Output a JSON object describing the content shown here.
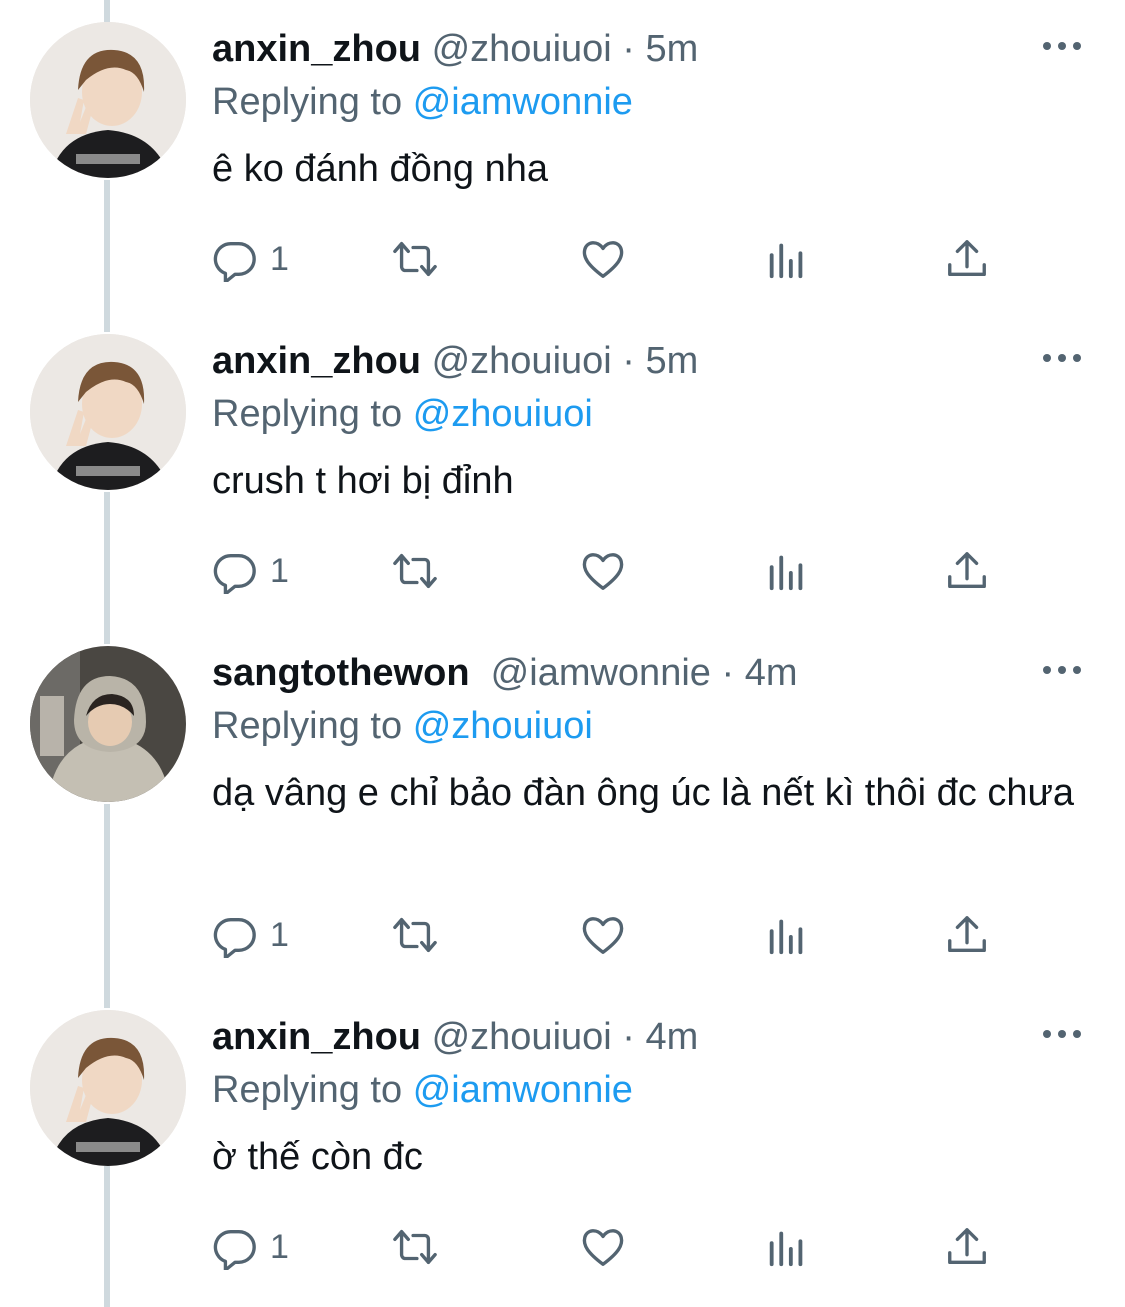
{
  "tweets": [
    {
      "name": "anxin_zhou",
      "handle": "@zhouiuoi",
      "dot": "·",
      "time": "5m",
      "replying_prefix": "Replying to",
      "replying_to": "@iamwonnie",
      "text": "ê ko đánh đồng nha",
      "reply_count": "1",
      "avatar": "avatar-peace-sign"
    },
    {
      "name": "anxin_zhou",
      "handle": "@zhouiuoi",
      "dot": "·",
      "time": "5m",
      "replying_prefix": "Replying to",
      "replying_to": "@zhouiuoi",
      "text": "crush t hơi bị đỉnh",
      "reply_count": "1",
      "avatar": "avatar-peace-sign"
    },
    {
      "name": "sangtothewon",
      "handle": "@iamwonnie",
      "dot": "·",
      "time": "4m",
      "replying_prefix": "Replying to",
      "replying_to": "@zhouiuoi",
      "text": "dạ vâng e chỉ bảo đàn ông úc là nết kì thôi đc chưa",
      "reply_count": "1",
      "avatar": "avatar-hoodie"
    },
    {
      "name": "anxin_zhou",
      "handle": "@zhouiuoi",
      "dot": "·",
      "time": "4m",
      "replying_prefix": "Replying to",
      "replying_to": "@iamwonnie",
      "text": "ờ thế còn đc",
      "reply_count": "1",
      "avatar": "avatar-peace-sign"
    }
  ],
  "icons": {
    "reply": "reply-icon",
    "retweet": "retweet-icon",
    "like": "heart-icon",
    "views": "views-icon",
    "share": "share-icon",
    "more": "more-icon"
  },
  "colors": {
    "text": "#0f1419",
    "secondary": "#536471",
    "accent": "#1d9bf0",
    "thread_line": "#cfd9de"
  }
}
